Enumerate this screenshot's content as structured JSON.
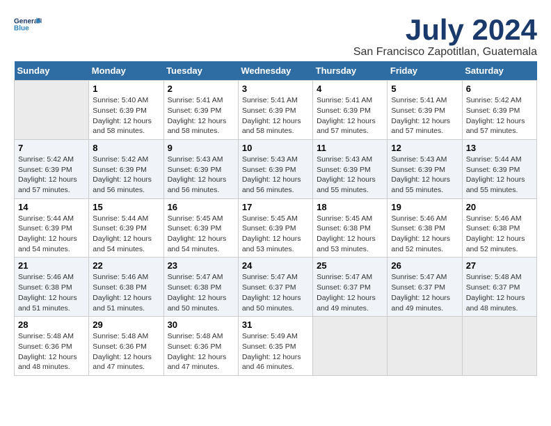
{
  "header": {
    "logo_general": "General",
    "logo_blue": "Blue",
    "month_title": "July 2024",
    "subtitle": "San Francisco Zapotitlan, Guatemala"
  },
  "days_of_week": [
    "Sunday",
    "Monday",
    "Tuesday",
    "Wednesday",
    "Thursday",
    "Friday",
    "Saturday"
  ],
  "weeks": [
    [
      {
        "day": "",
        "info": ""
      },
      {
        "day": "1",
        "info": "Sunrise: 5:40 AM\nSunset: 6:39 PM\nDaylight: 12 hours and 58 minutes."
      },
      {
        "day": "2",
        "info": "Sunrise: 5:41 AM\nSunset: 6:39 PM\nDaylight: 12 hours and 58 minutes."
      },
      {
        "day": "3",
        "info": "Sunrise: 5:41 AM\nSunset: 6:39 PM\nDaylight: 12 hours and 58 minutes."
      },
      {
        "day": "4",
        "info": "Sunrise: 5:41 AM\nSunset: 6:39 PM\nDaylight: 12 hours and 57 minutes."
      },
      {
        "day": "5",
        "info": "Sunrise: 5:41 AM\nSunset: 6:39 PM\nDaylight: 12 hours and 57 minutes."
      },
      {
        "day": "6",
        "info": "Sunrise: 5:42 AM\nSunset: 6:39 PM\nDaylight: 12 hours and 57 minutes."
      }
    ],
    [
      {
        "day": "7",
        "info": "Sunrise: 5:42 AM\nSunset: 6:39 PM\nDaylight: 12 hours and 57 minutes."
      },
      {
        "day": "8",
        "info": "Sunrise: 5:42 AM\nSunset: 6:39 PM\nDaylight: 12 hours and 56 minutes."
      },
      {
        "day": "9",
        "info": "Sunrise: 5:43 AM\nSunset: 6:39 PM\nDaylight: 12 hours and 56 minutes."
      },
      {
        "day": "10",
        "info": "Sunrise: 5:43 AM\nSunset: 6:39 PM\nDaylight: 12 hours and 56 minutes."
      },
      {
        "day": "11",
        "info": "Sunrise: 5:43 AM\nSunset: 6:39 PM\nDaylight: 12 hours and 55 minutes."
      },
      {
        "day": "12",
        "info": "Sunrise: 5:43 AM\nSunset: 6:39 PM\nDaylight: 12 hours and 55 minutes."
      },
      {
        "day": "13",
        "info": "Sunrise: 5:44 AM\nSunset: 6:39 PM\nDaylight: 12 hours and 55 minutes."
      }
    ],
    [
      {
        "day": "14",
        "info": "Sunrise: 5:44 AM\nSunset: 6:39 PM\nDaylight: 12 hours and 54 minutes."
      },
      {
        "day": "15",
        "info": "Sunrise: 5:44 AM\nSunset: 6:39 PM\nDaylight: 12 hours and 54 minutes."
      },
      {
        "day": "16",
        "info": "Sunrise: 5:45 AM\nSunset: 6:39 PM\nDaylight: 12 hours and 54 minutes."
      },
      {
        "day": "17",
        "info": "Sunrise: 5:45 AM\nSunset: 6:39 PM\nDaylight: 12 hours and 53 minutes."
      },
      {
        "day": "18",
        "info": "Sunrise: 5:45 AM\nSunset: 6:38 PM\nDaylight: 12 hours and 53 minutes."
      },
      {
        "day": "19",
        "info": "Sunrise: 5:46 AM\nSunset: 6:38 PM\nDaylight: 12 hours and 52 minutes."
      },
      {
        "day": "20",
        "info": "Sunrise: 5:46 AM\nSunset: 6:38 PM\nDaylight: 12 hours and 52 minutes."
      }
    ],
    [
      {
        "day": "21",
        "info": "Sunrise: 5:46 AM\nSunset: 6:38 PM\nDaylight: 12 hours and 51 minutes."
      },
      {
        "day": "22",
        "info": "Sunrise: 5:46 AM\nSunset: 6:38 PM\nDaylight: 12 hours and 51 minutes."
      },
      {
        "day": "23",
        "info": "Sunrise: 5:47 AM\nSunset: 6:38 PM\nDaylight: 12 hours and 50 minutes."
      },
      {
        "day": "24",
        "info": "Sunrise: 5:47 AM\nSunset: 6:37 PM\nDaylight: 12 hours and 50 minutes."
      },
      {
        "day": "25",
        "info": "Sunrise: 5:47 AM\nSunset: 6:37 PM\nDaylight: 12 hours and 49 minutes."
      },
      {
        "day": "26",
        "info": "Sunrise: 5:47 AM\nSunset: 6:37 PM\nDaylight: 12 hours and 49 minutes."
      },
      {
        "day": "27",
        "info": "Sunrise: 5:48 AM\nSunset: 6:37 PM\nDaylight: 12 hours and 48 minutes."
      }
    ],
    [
      {
        "day": "28",
        "info": "Sunrise: 5:48 AM\nSunset: 6:36 PM\nDaylight: 12 hours and 48 minutes."
      },
      {
        "day": "29",
        "info": "Sunrise: 5:48 AM\nSunset: 6:36 PM\nDaylight: 12 hours and 47 minutes."
      },
      {
        "day": "30",
        "info": "Sunrise: 5:48 AM\nSunset: 6:36 PM\nDaylight: 12 hours and 47 minutes."
      },
      {
        "day": "31",
        "info": "Sunrise: 5:49 AM\nSunset: 6:35 PM\nDaylight: 12 hours and 46 minutes."
      },
      {
        "day": "",
        "info": ""
      },
      {
        "day": "",
        "info": ""
      },
      {
        "day": "",
        "info": ""
      }
    ]
  ]
}
